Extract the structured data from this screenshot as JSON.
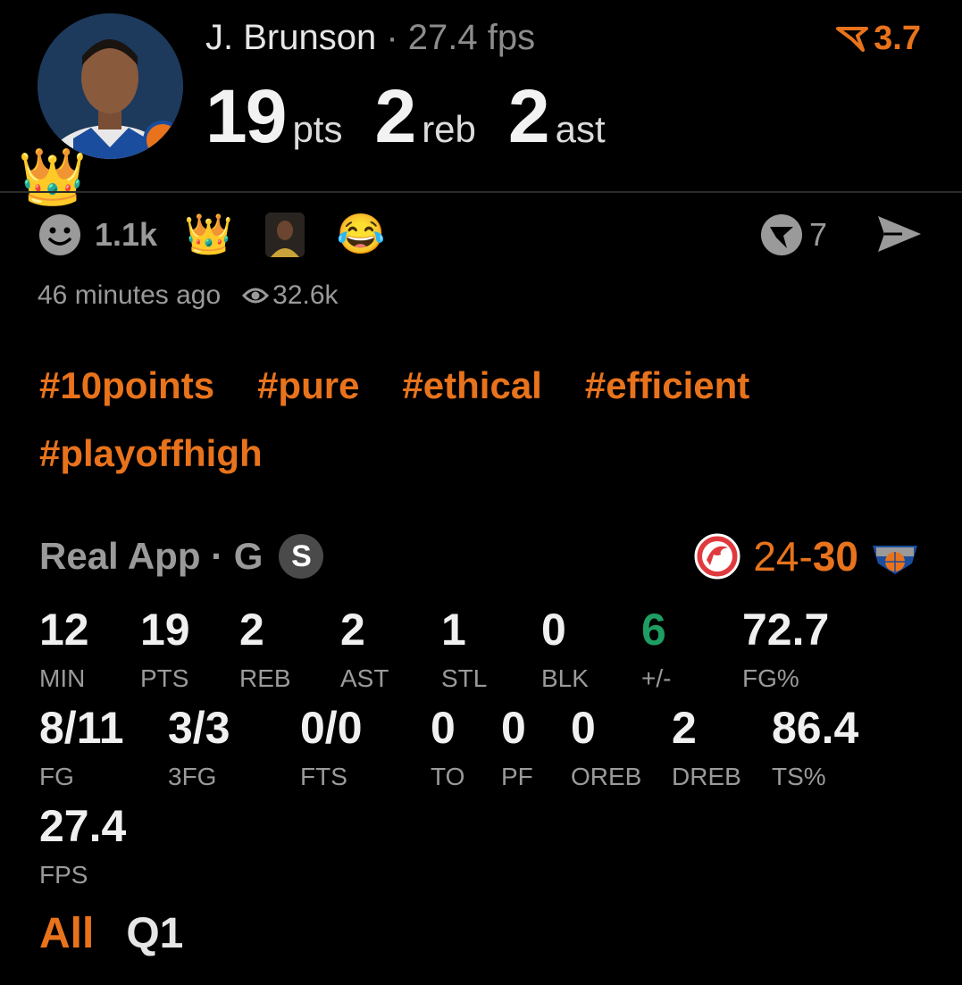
{
  "player": {
    "name": "J. Brunson",
    "separator": "·",
    "fps_text": "27.4 fps",
    "rating": "3.7",
    "pts": "19",
    "pts_label": "pts",
    "reb": "2",
    "reb_label": "reb",
    "ast": "2",
    "ast_label": "ast"
  },
  "reactions": {
    "count": "1.1k",
    "comments": "7",
    "time": "46 minutes ago",
    "views": "32.6k"
  },
  "tags": [
    "#10points",
    "#pure",
    "#ethical",
    "#efficient",
    "#playoffhigh"
  ],
  "game": {
    "app_label": "Real App · G",
    "badge": "S",
    "score_left": "24-",
    "score_right": "30"
  },
  "stats": [
    {
      "value": "12",
      "label": "MIN"
    },
    {
      "value": "19",
      "label": "PTS"
    },
    {
      "value": "2",
      "label": "REB"
    },
    {
      "value": "2",
      "label": "AST"
    },
    {
      "value": "1",
      "label": "STL"
    },
    {
      "value": "0",
      "label": "BLK"
    },
    {
      "value": "6",
      "label": "+/-"
    },
    {
      "value": "72.7",
      "label": "FG%"
    },
    {
      "value": "8/11",
      "label": "FG"
    },
    {
      "value": "3/3",
      "label": "3FG"
    },
    {
      "value": "0/0",
      "label": "FTS"
    },
    {
      "value": "0",
      "label": "TO"
    },
    {
      "value": "0",
      "label": "PF"
    },
    {
      "value": "0",
      "label": "OREB"
    },
    {
      "value": "2",
      "label": "DREB"
    },
    {
      "value": "86.4",
      "label": "TS%"
    },
    {
      "value": "27.4",
      "label": "FPS"
    }
  ],
  "tabs": [
    "All",
    "Q1"
  ],
  "colors": {
    "accent": "#e8731c",
    "positive": "#1e9e63",
    "muted": "#9a9a9a",
    "background": "#000000"
  },
  "icons": {
    "rating": "flag-icon",
    "reaction": "smiley-icon",
    "comment": "comment-icon",
    "send": "send-icon",
    "views": "eye-icon",
    "away_team": "hawks-logo",
    "home_team": "knicks-logo"
  }
}
